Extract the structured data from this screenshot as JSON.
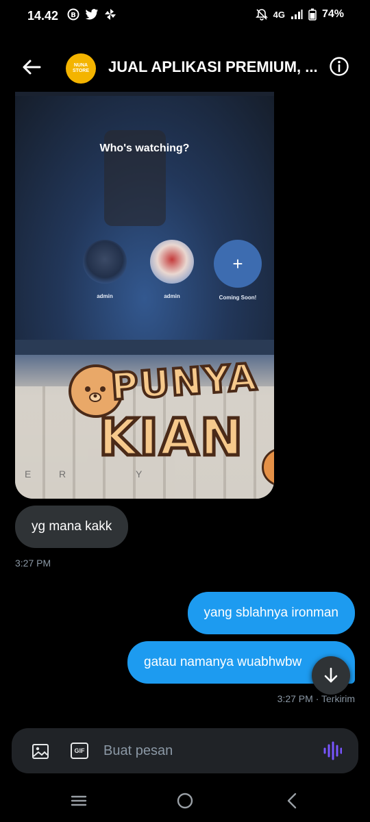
{
  "status_bar": {
    "time": "14.42",
    "network": "4G",
    "battery": "74%"
  },
  "header": {
    "title": "JUAL APLIKASI PREMIUM, ...",
    "avatar_text": "NUNA STORE"
  },
  "photo": {
    "screen_title": "Who's watching?",
    "profiles": [
      {
        "label": "admin"
      },
      {
        "label": "admin"
      },
      {
        "label": "Coming Soon!"
      }
    ],
    "sticker_line1": "PUNYA",
    "sticker_line2": "KIAN",
    "keyboard_letters": [
      "E",
      "R",
      "Y"
    ]
  },
  "messages": {
    "incoming": {
      "text": "yg mana kakk",
      "time": "3:27 PM"
    },
    "outgoing": [
      {
        "text": "yang sblahnya ironman"
      },
      {
        "text": "gatau namanya wuabhwbw"
      }
    ],
    "outgoing_meta": "3:27 PM · Terkirim"
  },
  "composer": {
    "placeholder": "Buat pesan",
    "gif_label": "GIF"
  },
  "colors": {
    "accent": "#1d9bf0",
    "incoming_bubble": "#2f3336",
    "voice": "#7856ff"
  }
}
